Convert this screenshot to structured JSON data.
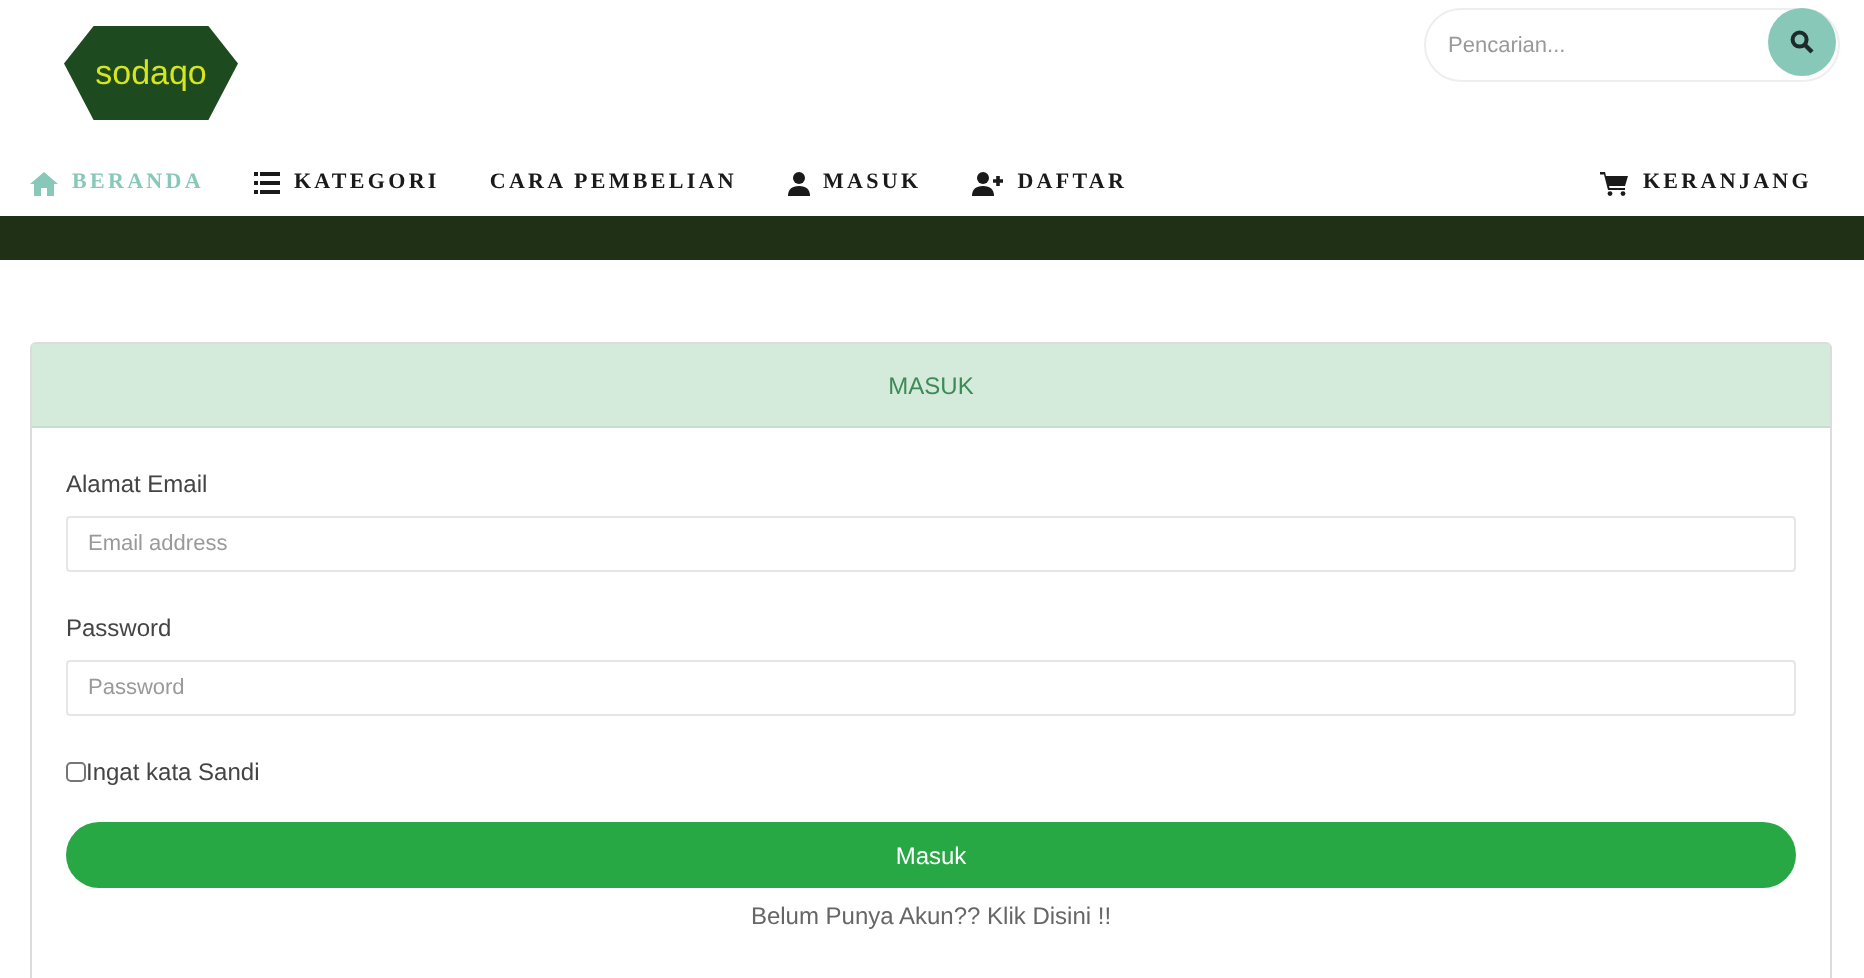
{
  "logo": {
    "text": "sodaqo"
  },
  "search": {
    "placeholder": "Pencarian..."
  },
  "nav": [
    {
      "label": "BERANDA",
      "kind": "home",
      "selected": true
    },
    {
      "label": "KATEGORI",
      "kind": "list",
      "selected": false
    },
    {
      "label": "CARA PEMBELIAN",
      "kind": "plain",
      "selected": false
    },
    {
      "label": "MASUK",
      "kind": "user",
      "selected": false
    },
    {
      "label": "DAFTAR",
      "kind": "user-plus",
      "selected": false
    }
  ],
  "cart": {
    "label": "KERANJANG"
  },
  "card": {
    "title": "MASUK",
    "fields": [
      {
        "label": "Alamat Email",
        "placeholder": "Email address"
      },
      {
        "label": "Password",
        "placeholder": "Password"
      }
    ],
    "remember": {
      "label": "Ingat kata Sandi",
      "checked": false
    },
    "submit": "Masuk",
    "register_link": "Belum Punya Akun?? Klik Disini !!"
  }
}
